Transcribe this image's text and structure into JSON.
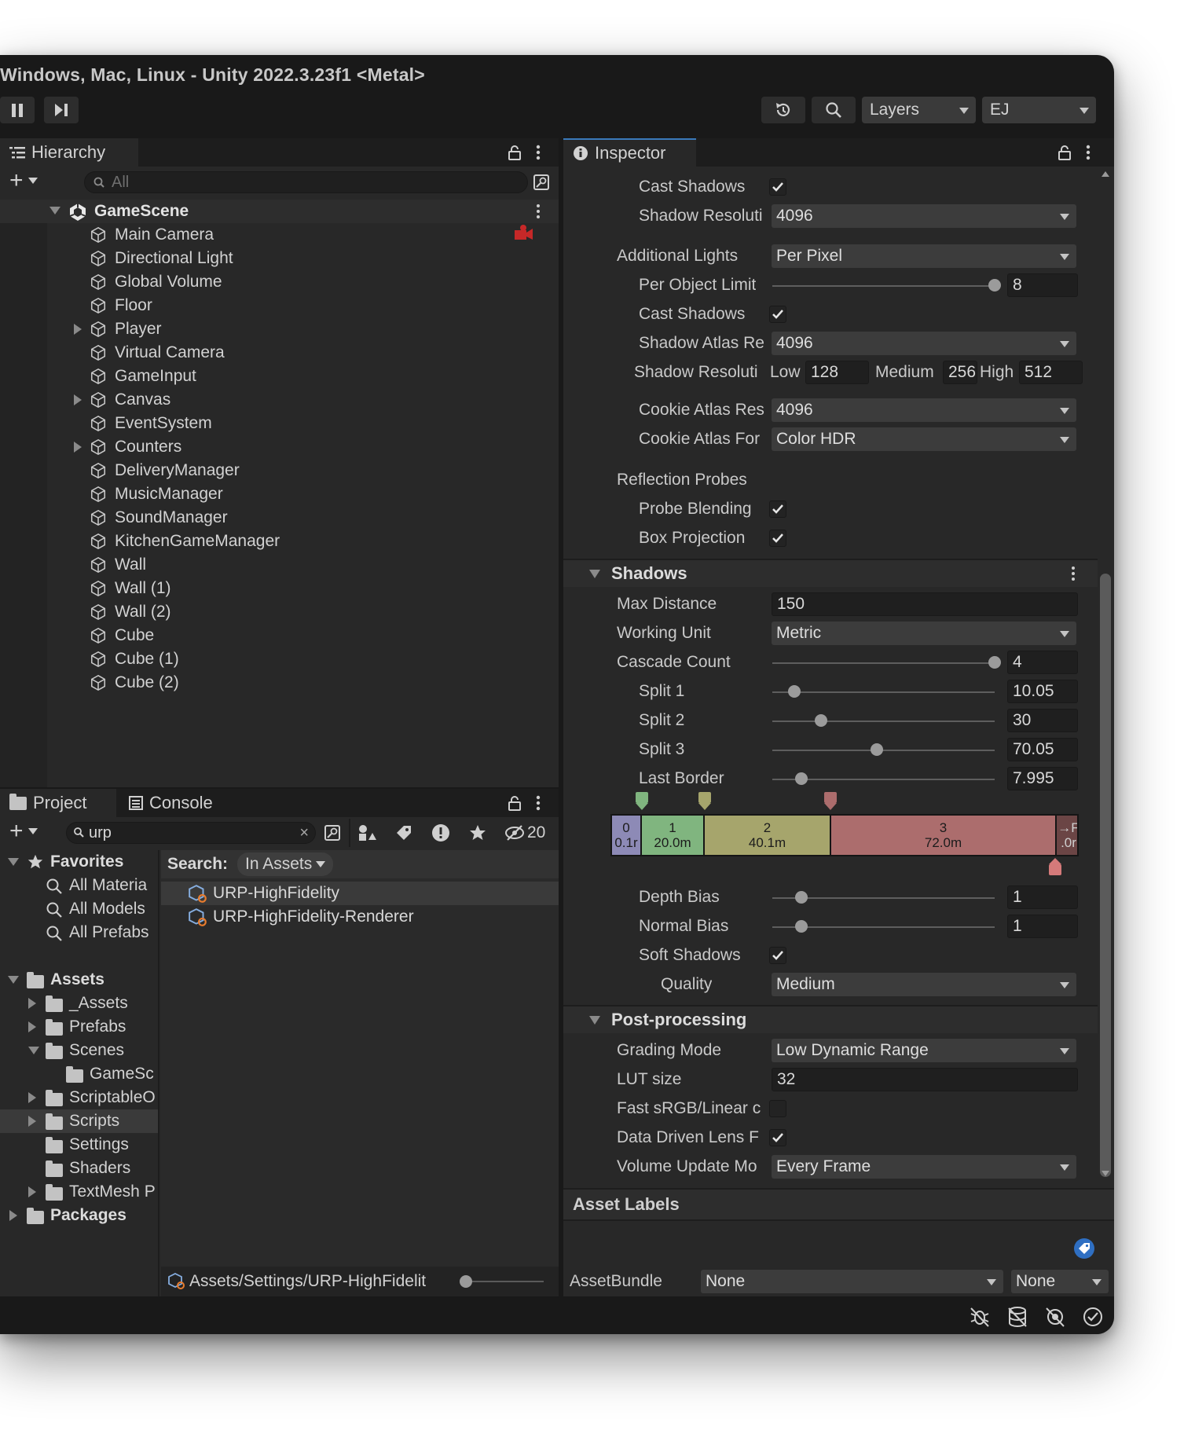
{
  "window": {
    "title": "Windows, Mac, Linux - Unity 2022.3.23f1 <Metal>"
  },
  "toolbar": {
    "layers_label": "Layers",
    "layout_label": "EJ"
  },
  "hierarchy": {
    "tab_label": "Hierarchy",
    "search_placeholder": "All",
    "scene": "GameScene",
    "items": [
      "Main Camera",
      "Directional Light",
      "Global Volume",
      "Floor",
      "Player",
      "Virtual Camera",
      "GameInput",
      "Canvas",
      "EventSystem",
      "Counters",
      "DeliveryManager",
      "MusicManager",
      "SoundManager",
      "KitchenGameManager",
      "Wall",
      "Wall (1)",
      "Wall (2)",
      "Cube",
      "Cube (1)",
      "Cube (2)"
    ]
  },
  "project": {
    "tab_project": "Project",
    "tab_console": "Console",
    "search_value": "urp",
    "hidden_count": "20",
    "favorites": {
      "label": "Favorites",
      "items": [
        "All Materia",
        "All Models",
        "All Prefabs"
      ]
    },
    "assets": {
      "label": "Assets",
      "items": [
        "_Assets",
        "Prefabs",
        "Scenes",
        "GameSc",
        "ScriptableO",
        "Scripts",
        "Settings",
        "Shaders",
        "TextMesh P"
      ]
    },
    "packages": "Packages",
    "search_label": "Search:",
    "search_scope": "In Assets",
    "results": [
      "URP-HighFidelity",
      "URP-HighFidelity-Renderer"
    ],
    "footer_path": "Assets/Settings/URP-HighFidelit"
  },
  "inspector": {
    "tab_label": "Inspector",
    "main_light": {
      "cast_shadows": "Cast Shadows",
      "shadow_resolution": "Shadow Resoluti",
      "shadow_resolution_value": "4096"
    },
    "additional_lights": {
      "label": "Additional Lights",
      "value": "Per Pixel",
      "per_object_limit": "Per Object Limit",
      "per_object_limit_value": "8",
      "cast_shadows": "Cast Shadows",
      "shadow_atlas": "Shadow Atlas Re",
      "shadow_atlas_value": "4096",
      "shadow_res": "Shadow Resoluti",
      "low": "Low",
      "low_value": "128",
      "medium": "Medium",
      "medium_value": "256",
      "high": "High",
      "high_value": "512",
      "cookie_atlas_res": "Cookie Atlas Res",
      "cookie_atlas_res_value": "4096",
      "cookie_atlas_format": "Cookie Atlas For",
      "cookie_atlas_format_value": "Color HDR"
    },
    "reflection_probes": {
      "label": "Reflection Probes",
      "probe_blending": "Probe Blending",
      "box_projection": "Box Projection"
    },
    "shadows": {
      "header": "Shadows",
      "max_distance": "Max Distance",
      "max_distance_value": "150",
      "working_unit": "Working Unit",
      "working_unit_value": "Metric",
      "cascade_count": "Cascade Count",
      "cascade_count_value": "4",
      "split1": "Split 1",
      "split1_value": "10.05",
      "split2": "Split 2",
      "split2_value": "30",
      "split3": "Split 3",
      "split3_value": "70.05",
      "last_border": "Last Border",
      "last_border_value": "7.995",
      "cascades": [
        {
          "idx": "0",
          "dist": "0.1r"
        },
        {
          "idx": "1",
          "dist": "20.0m"
        },
        {
          "idx": "2",
          "dist": "40.1m"
        },
        {
          "idx": "3",
          "dist": "72.0m"
        },
        {
          "idx": "→F",
          "dist": ".0r"
        }
      ],
      "depth_bias": "Depth Bias",
      "depth_bias_value": "1",
      "normal_bias": "Normal Bias",
      "normal_bias_value": "1",
      "soft_shadows": "Soft Shadows",
      "quality": "Quality",
      "quality_value": "Medium"
    },
    "post": {
      "header": "Post-processing",
      "grading_mode": "Grading Mode",
      "grading_mode_value": "Low Dynamic Range",
      "lut_size": "LUT size",
      "lut_size_value": "32",
      "fast_srgb": "Fast sRGB/Linear c",
      "data_driven": "Data Driven Lens F",
      "volume_update": "Volume Update Mo",
      "volume_update_value": "Every Frame"
    },
    "asset_labels": "Asset Labels",
    "asset_bundle": {
      "label": "AssetBundle",
      "value": "None",
      "variant": "None"
    }
  },
  "slider_levels": {
    "per_object_limit": 1.0,
    "cascade_count": 1.0,
    "split1": 0.1,
    "split2": 0.22,
    "split3": 0.47,
    "last_border": 0.13,
    "depth_bias": 0.13,
    "normal_bias": 0.13
  },
  "colors": {
    "accent": "#3a79bb",
    "cascade0": "#8d8ab6",
    "cascade1": "#80b57f",
    "cascade2": "#a6a56c",
    "cascade3": "#ac6d6d"
  }
}
